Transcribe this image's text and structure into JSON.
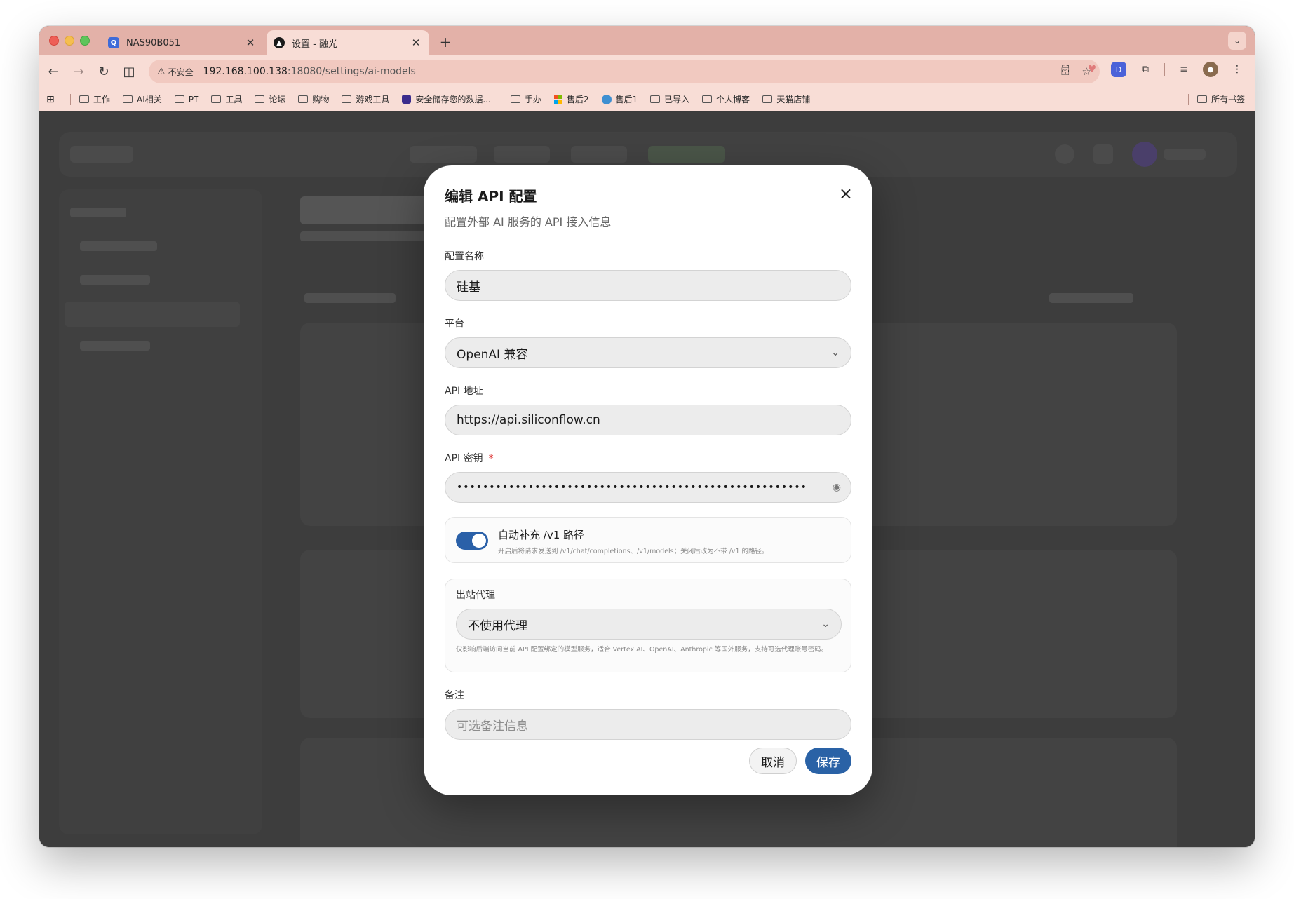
{
  "browser": {
    "tabs": [
      {
        "title": "NAS90B051",
        "favicon": "qnap-icon"
      },
      {
        "title": "设置 - 融光",
        "favicon": "app-icon"
      }
    ],
    "insecure_label": "不安全",
    "url_host": "192.168.100.138",
    "url_path": ":18080/settings/ai-models",
    "bookmarks": [
      "工作",
      "AI相关",
      "PT",
      "工具",
      "论坛",
      "购物",
      "游戏工具",
      "安全储存您的数据...",
      "手办",
      "售后2",
      "售后1",
      "已导入",
      "个人博客",
      "天猫店铺"
    ],
    "all_bookmarks": "所有书签",
    "accent_color": "#e3b1a8"
  },
  "modal": {
    "title": "编辑 API 配置",
    "subtitle": "配置外部 AI 服务的 API 接入信息",
    "close_icon": "×",
    "fields": {
      "name_label": "配置名称",
      "name_value": "硅基",
      "platform_label": "平台",
      "platform_value": "OpenAI 兼容",
      "url_label": "API 地址",
      "url_value": "https://api.siliconflow.cn",
      "key_label": "API 密钥",
      "key_required": "*",
      "key_value": "••••••••••••••••••••••••••••••••••••••••••••••••••••••",
      "notes_label": "备注",
      "notes_placeholder": "可选备注信息"
    },
    "auto_v1": {
      "title": "自动补充 /v1 路径",
      "description": "开启后将请求发送到 /v1/chat/completions、/v1/models；关闭后改为不带 /v1 的路径。",
      "enabled": true
    },
    "proxy": {
      "label": "出站代理",
      "value": "不使用代理",
      "hint": "仅影响后端访问当前 API 配置绑定的模型服务，适合 Vertex AI、OpenAI、Anthropic 等国外服务，支持可选代理账号密码。"
    },
    "buttons": {
      "cancel": "取消",
      "save": "保存"
    },
    "primary_color": "#2a62a6"
  }
}
